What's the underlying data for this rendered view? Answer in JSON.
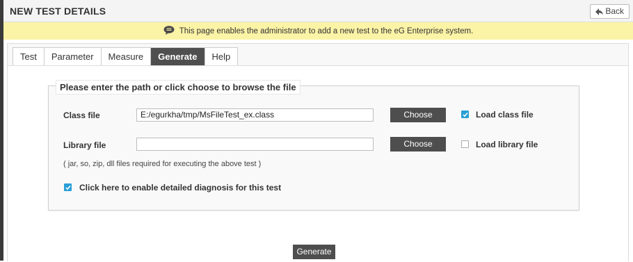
{
  "header": {
    "title": "NEW TEST DETAILS",
    "back_label": "Back"
  },
  "banner": {
    "message": "This page enables the administrator to add a new test to the eG Enterprise system."
  },
  "tabs": [
    {
      "label": "Test",
      "active": false
    },
    {
      "label": "Parameter",
      "active": false
    },
    {
      "label": "Measure",
      "active": false
    },
    {
      "label": "Generate",
      "active": true
    },
    {
      "label": "Help",
      "active": false
    }
  ],
  "form": {
    "legend": "Please enter the path or click choose to browse the file",
    "class_file": {
      "label": "Class file",
      "value": "E:/egurkha/tmp/MsFileTest_ex.class",
      "choose_label": "Choose",
      "checkbox_label": "Load class file",
      "checked": true
    },
    "library_file": {
      "label": "Library file",
      "value": "",
      "choose_label": "Choose",
      "checkbox_label": "Load library file",
      "checked": false
    },
    "note": "( jar, so, zip, dll files required for executing the above test )",
    "diagnosis": {
      "label": "Click here to enable detailed diagnosis for this test",
      "checked": true
    }
  },
  "generate_label": "Generate",
  "colors": {
    "banner_bg": "#fbf3a6",
    "active_tab_bg": "#4f4f4f",
    "checkbox_checked": "#2a9fd6",
    "dark_button": "#4e4e4e"
  }
}
